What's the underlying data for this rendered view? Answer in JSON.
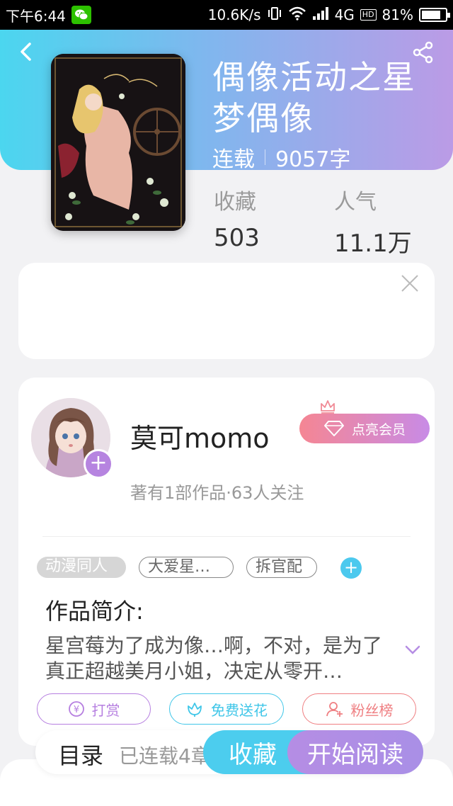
{
  "status_bar": {
    "time": "下午6:44",
    "network_speed": "10.6K/s",
    "network_type": "4G",
    "hd_label": "HD",
    "battery_percent": "81%",
    "battery_level": 0.81
  },
  "book": {
    "title": "偶像活动之星梦偶像",
    "status": "连载",
    "word_count": "9057字",
    "stats": [
      {
        "label": "收藏",
        "value": "503"
      },
      {
        "label": "人气",
        "value": "11.1万"
      }
    ]
  },
  "author": {
    "name": "莫可momo",
    "vip_label": "点亮会员",
    "stats": "著有1部作品·63人关注"
  },
  "tags": [
    "动漫同人",
    "大爱星…",
    "拆官配"
  ],
  "intro": {
    "title": "作品简介:",
    "text": "星宫莓为了成为像…啊，不对，是为了真正超越美月小姐，决定从零开…"
  },
  "actions": [
    {
      "label": "打赏",
      "icon": "coin-icon",
      "color": "#b67fe0"
    },
    {
      "label": "免费送花",
      "icon": "flower-icon",
      "color": "#3fc6e8"
    },
    {
      "label": "粉丝榜",
      "icon": "fan-icon",
      "color": "#ef7f82"
    }
  ],
  "bottom": {
    "toc_label": "目录",
    "toc_progress": "已连载4章",
    "fav_label": "收藏",
    "read_label": "开始阅读"
  },
  "colors": {
    "header_start": "#4bd6ef",
    "header_end": "#bb9be6",
    "accent_blue": "#4ccdee",
    "accent_purple": "#b58de4"
  }
}
